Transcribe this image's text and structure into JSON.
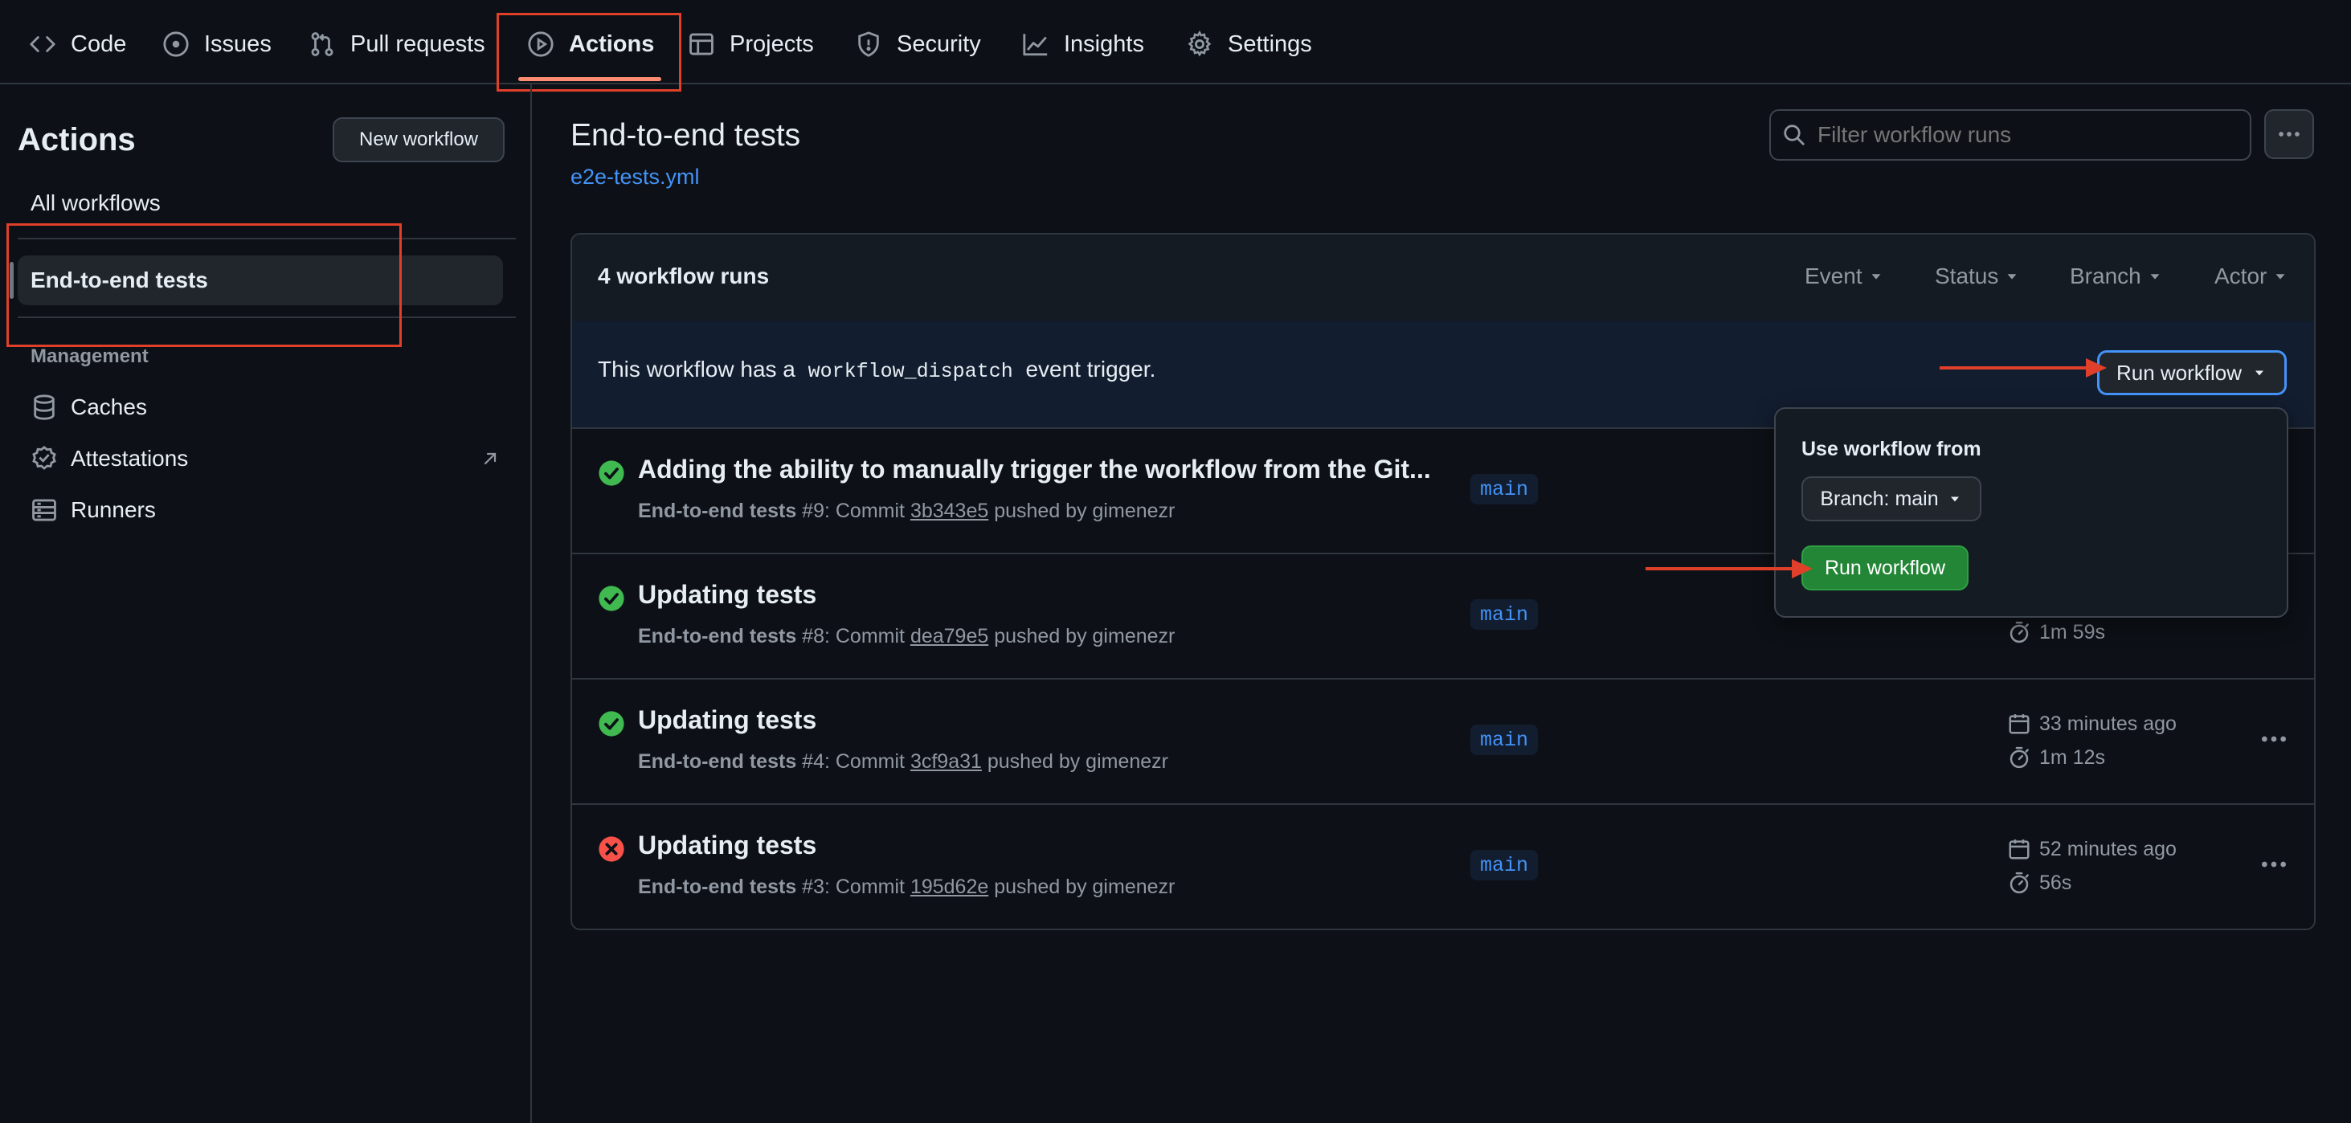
{
  "topnav": {
    "tabs": [
      {
        "label": "Code",
        "icon": "code-icon"
      },
      {
        "label": "Issues",
        "icon": "issue-opened-icon"
      },
      {
        "label": "Pull requests",
        "icon": "git-pull-request-icon"
      },
      {
        "label": "Actions",
        "icon": "play-icon",
        "active": true
      },
      {
        "label": "Projects",
        "icon": "table-icon"
      },
      {
        "label": "Security",
        "icon": "shield-icon"
      },
      {
        "label": "Insights",
        "icon": "graph-icon"
      },
      {
        "label": "Settings",
        "icon": "gear-icon"
      }
    ]
  },
  "sidebar": {
    "title": "Actions",
    "new_workflow": "New workflow",
    "all_workflows": "All workflows",
    "selected_workflow": "End-to-end tests",
    "management_heading": "Management",
    "management_items": [
      {
        "label": "Caches",
        "icon": "database-icon"
      },
      {
        "label": "Attestations",
        "icon": "verified-icon",
        "external": true
      },
      {
        "label": "Runners",
        "icon": "server-icon"
      }
    ]
  },
  "main": {
    "title": "End-to-end tests",
    "file_link": "e2e-tests.yml",
    "search_placeholder": "Filter workflow runs",
    "runs_count": "4 workflow runs",
    "filters": [
      "Event",
      "Status",
      "Branch",
      "Actor"
    ],
    "dispatch": {
      "text_before": "This workflow has a",
      "code": "workflow_dispatch",
      "text_after": "event trigger.",
      "button": "Run workflow"
    },
    "runs": [
      {
        "title": "Adding the ability to manually trigger the workflow from the Git...",
        "workflow": "End-to-end tests",
        "number": "#9",
        "commit_label": ": Commit",
        "commit": "3b343e5",
        "pushed": "pushed by gimenezr",
        "branch": "main",
        "status": "success",
        "time": "",
        "duration": ""
      },
      {
        "title": "Updating tests",
        "workflow": "End-to-end tests",
        "number": "#8",
        "commit_label": ": Commit",
        "commit": "dea79e5",
        "pushed": "pushed by gimenezr",
        "branch": "main",
        "status": "success",
        "time": "",
        "duration": "1m 59s"
      },
      {
        "title": "Updating tests",
        "workflow": "End-to-end tests",
        "number": "#4",
        "commit_label": ": Commit",
        "commit": "3cf9a31",
        "pushed": "pushed by gimenezr",
        "branch": "main",
        "status": "success",
        "time": "33 minutes ago",
        "duration": "1m 12s"
      },
      {
        "title": "Updating tests",
        "workflow": "End-to-end tests",
        "number": "#3",
        "commit_label": ": Commit",
        "commit": "195d62e",
        "pushed": "pushed by gimenezr",
        "branch": "main",
        "status": "failure",
        "time": "52 minutes ago",
        "duration": "56s"
      }
    ]
  },
  "dropdown": {
    "heading": "Use workflow from",
    "branch_select": "Branch: main",
    "run_button": "Run workflow"
  },
  "colors": {
    "background": "#0d1117",
    "accent_blue": "#4493f8",
    "success_green": "#3fb950",
    "failure_red": "#f85149",
    "run_button_green": "#238636",
    "annotation_red": "#e0402a",
    "active_underline": "#fd8c73"
  }
}
